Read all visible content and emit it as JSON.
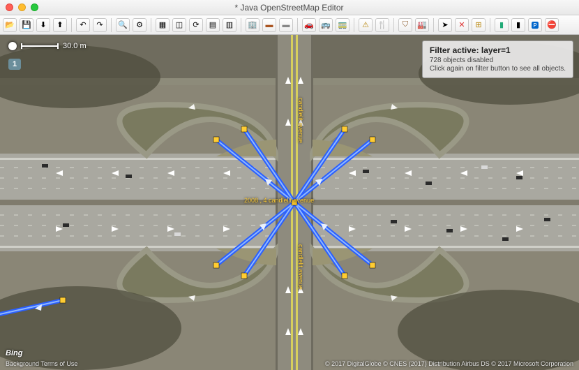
{
  "window": {
    "title": "* Java OpenStreetMap Editor"
  },
  "scale": {
    "label": "30.0 m"
  },
  "layer": {
    "badge": "1"
  },
  "filter": {
    "title": "Filter active: layer=1",
    "count": "728 objects disabled",
    "hint": "Click again on filter button to see all objects."
  },
  "imagery": {
    "provider": "Bing",
    "terms": "Background Terms of Use",
    "attribution": "© 2017 DigitalGlobe © CNES (2017) Distribution Airbus DS © 2017 Microsoft Corporation"
  },
  "labels": {
    "road_ns": "candlelit avenue",
    "road_info": "2008 , 4 candlelit avenue"
  },
  "colors": {
    "highway": "#2a5fff",
    "highway_edge": "#6fa0ff",
    "label": "#ffcc33",
    "filter_bg": "#ebebeb"
  }
}
